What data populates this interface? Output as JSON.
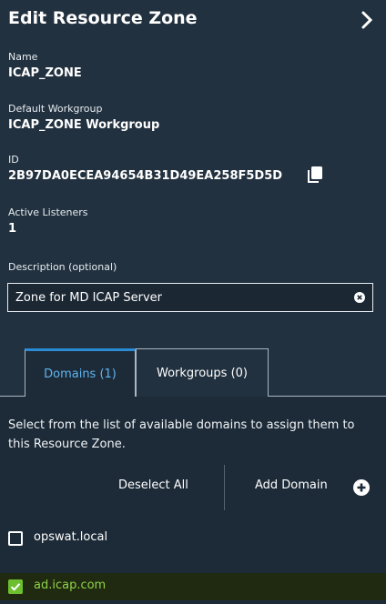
{
  "panel": {
    "title": "Edit Resource Zone"
  },
  "fields": {
    "name_label": "Name",
    "name_value": "ICAP_ZONE",
    "workgroup_label": "Default Workgroup",
    "workgroup_value": "ICAP_ZONE Workgroup",
    "id_label": "ID",
    "id_value": "2B97DA0ECEA94654B31D49EA258F5D5D",
    "listeners_label": "Active Listeners",
    "listeners_value": "1"
  },
  "description": {
    "label": "Description (optional)",
    "value": "Zone for MD ICAP Server"
  },
  "tabs": [
    {
      "label": "Domains (1)",
      "active": true
    },
    {
      "label": "Workgroups (0)",
      "active": false
    }
  ],
  "domains": {
    "help_text": "Select from the list of available domains to assign them to this Resource Zone.",
    "deselect_all": "Deselect All",
    "add_domain": "Add Domain",
    "items": [
      {
        "label": "opswat.local",
        "checked": false
      },
      {
        "label": "ad.icap.com",
        "checked": true
      }
    ]
  },
  "colors": {
    "background": "#22313f",
    "tab_accent": "#2a8bd4",
    "selected_green": "#6dbf2f"
  },
  "icons": [
    "chevron-right-icon",
    "copy-icon",
    "clear-icon",
    "add-icon",
    "checkbox-icon",
    "checkmark-icon"
  ]
}
